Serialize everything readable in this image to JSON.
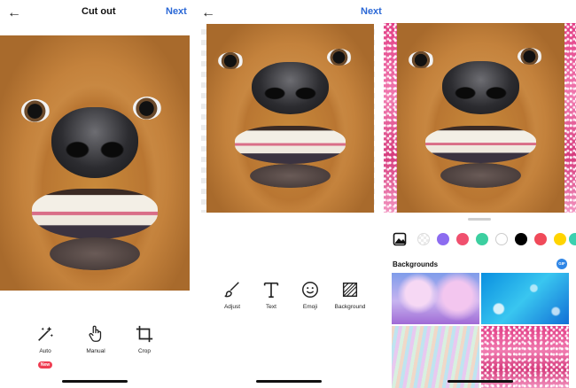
{
  "panel1": {
    "back_icon": "arrow-left-icon",
    "title": "Cut out",
    "next_label": "Next",
    "tools": [
      {
        "label": "Auto",
        "icon": "magic-wand-icon",
        "badge": "New"
      },
      {
        "label": "Manual",
        "icon": "hand-pointer-icon"
      },
      {
        "label": "Crop",
        "icon": "crop-icon"
      }
    ]
  },
  "panel2": {
    "back_icon": "arrow-left-icon",
    "next_label": "Next",
    "tools": [
      {
        "label": "Adjust",
        "icon": "brush-icon"
      },
      {
        "label": "Text",
        "icon": "text-icon"
      },
      {
        "label": "Emoji",
        "icon": "smiley-icon"
      },
      {
        "label": "Background",
        "icon": "background-pattern-icon"
      }
    ]
  },
  "panel3": {
    "swatches": [
      "image",
      "transparent",
      "#8c6cf0",
      "#f0506e",
      "#3ccfa0",
      "#ffffff",
      "#000000",
      "#f04a5a",
      "#ffd400",
      "#3bd1b0"
    ],
    "backgrounds_title": "Backgrounds",
    "gif_badge": "GIF",
    "thumbnails": [
      "cherry-blossom",
      "blue-bokeh",
      "holographic-rays",
      "pink-glitter"
    ]
  },
  "colors": {
    "accent": "#2b68d6",
    "badge": "#ef3d52"
  }
}
